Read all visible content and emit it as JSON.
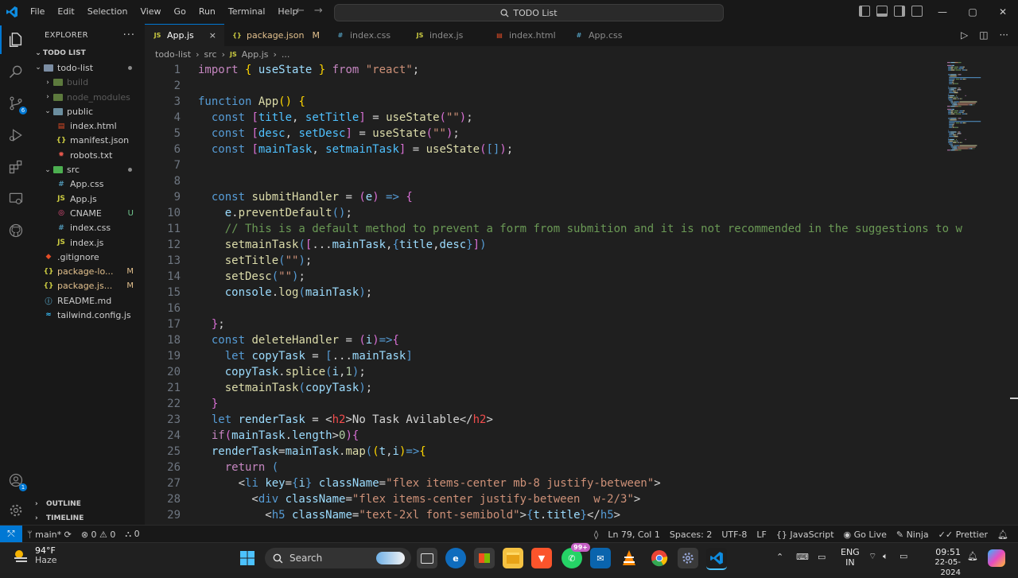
{
  "menu": [
    "File",
    "Edit",
    "Selection",
    "View",
    "Go",
    "Run",
    "Terminal",
    "Help"
  ],
  "command_center": "TODO List",
  "explorer": {
    "title": "EXPLORER",
    "section": "TODO LIST",
    "items": [
      {
        "label": "todo-list",
        "type": "folder-open",
        "depth": 1,
        "color": "#cccccc",
        "badge": "",
        "dot": true
      },
      {
        "label": "build",
        "type": "folder",
        "depth": 2,
        "color": "#5a5a5a",
        "badge": ""
      },
      {
        "label": "node_modules",
        "type": "folder",
        "depth": 2,
        "color": "#5a5a5a",
        "badge": ""
      },
      {
        "label": "public",
        "type": "folder-open",
        "depth": 2,
        "color": "#cccccc",
        "badge": ""
      },
      {
        "label": "index.html",
        "type": "html",
        "depth": 3,
        "color": "#cccccc",
        "badge": ""
      },
      {
        "label": "manifest.json",
        "type": "json",
        "depth": 3,
        "color": "#cccccc",
        "badge": ""
      },
      {
        "label": "robots.txt",
        "type": "txt",
        "depth": 3,
        "color": "#cccccc",
        "badge": ""
      },
      {
        "label": "src",
        "type": "folder-open",
        "depth": 2,
        "color": "#cccccc",
        "badge": "",
        "dot": true
      },
      {
        "label": "App.css",
        "type": "css",
        "depth": 3,
        "color": "#cccccc",
        "badge": ""
      },
      {
        "label": "App.js",
        "type": "js",
        "depth": 3,
        "color": "#cccccc",
        "badge": ""
      },
      {
        "label": "CNAME",
        "type": "cname",
        "depth": 3,
        "color": "#cccccc",
        "badge": "U"
      },
      {
        "label": "index.css",
        "type": "css",
        "depth": 3,
        "color": "#cccccc",
        "badge": ""
      },
      {
        "label": "index.js",
        "type": "js",
        "depth": 3,
        "color": "#cccccc",
        "badge": ""
      },
      {
        "label": ".gitignore",
        "type": "git",
        "depth": 2,
        "color": "#cccccc",
        "badge": ""
      },
      {
        "label": "package-lo...",
        "type": "json",
        "depth": 2,
        "color": "#e2c08d",
        "badge": "M"
      },
      {
        "label": "package.js...",
        "type": "json",
        "depth": 2,
        "color": "#e2c08d",
        "badge": "M"
      },
      {
        "label": "README.md",
        "type": "md",
        "depth": 2,
        "color": "#cccccc",
        "badge": ""
      },
      {
        "label": "tailwind.config.js",
        "type": "tw",
        "depth": 2,
        "color": "#cccccc",
        "badge": ""
      }
    ],
    "outline": "OUTLINE",
    "timeline": "TIMELINE"
  },
  "tabs": [
    {
      "label": "App.js",
      "icon": "js",
      "active": true,
      "suffix": "×"
    },
    {
      "label": "package.json",
      "icon": "json",
      "active": false,
      "suffix": "M"
    },
    {
      "label": "index.css",
      "icon": "css",
      "active": false,
      "suffix": ""
    },
    {
      "label": "index.js",
      "icon": "js",
      "active": false,
      "suffix": ""
    },
    {
      "label": "index.html",
      "icon": "html",
      "active": false,
      "suffix": ""
    },
    {
      "label": "App.css",
      "icon": "css",
      "active": false,
      "suffix": ""
    }
  ],
  "breadcrumb": [
    "todo-list",
    "src",
    "App.js",
    "..."
  ],
  "code_lines": [
    [
      [
        "k",
        "import "
      ],
      [
        "p",
        "{ "
      ],
      [
        "v",
        "useState"
      ],
      [
        "p",
        " }"
      ],
      [
        "k",
        " from "
      ],
      [
        "s",
        "\"react\""
      ],
      [
        "",
        "; "
      ]
    ],
    [],
    [
      [
        "t",
        "function "
      ],
      [
        "f",
        "App"
      ],
      [
        "p",
        "() {"
      ]
    ],
    [
      [
        "",
        "  "
      ],
      [
        "t",
        "const "
      ],
      [
        "b",
        "["
      ],
      [
        "cv",
        "title"
      ],
      [
        "",
        ", "
      ],
      [
        "cv",
        "setTitle"
      ],
      [
        "b",
        "]"
      ],
      [
        "",
        " = "
      ],
      [
        "f",
        "useState"
      ],
      [
        "b",
        "("
      ],
      [
        "s",
        "\"\""
      ],
      [
        "b",
        ")"
      ],
      [
        "",
        ";"
      ]
    ],
    [
      [
        "",
        "  "
      ],
      [
        "t",
        "const "
      ],
      [
        "b",
        "["
      ],
      [
        "cv",
        "desc"
      ],
      [
        "",
        ", "
      ],
      [
        "cv",
        "setDesc"
      ],
      [
        "b",
        "]"
      ],
      [
        "",
        " = "
      ],
      [
        "f",
        "useState"
      ],
      [
        "b",
        "("
      ],
      [
        "s",
        "\"\""
      ],
      [
        "b",
        ")"
      ],
      [
        "",
        ";"
      ]
    ],
    [
      [
        "",
        "  "
      ],
      [
        "t",
        "const "
      ],
      [
        "b",
        "["
      ],
      [
        "cv",
        "mainTask"
      ],
      [
        "",
        ", "
      ],
      [
        "cv",
        "setmainTask"
      ],
      [
        "b",
        "]"
      ],
      [
        "",
        " = "
      ],
      [
        "f",
        "useState"
      ],
      [
        "b",
        "("
      ],
      [
        "t",
        "[]"
      ],
      [
        "b",
        ")"
      ],
      [
        "",
        ";"
      ]
    ],
    [],
    [],
    [
      [
        "",
        "  "
      ],
      [
        "t",
        "const "
      ],
      [
        "f",
        "submitHandler"
      ],
      [
        "",
        " = "
      ],
      [
        "b",
        "("
      ],
      [
        "v",
        "e"
      ],
      [
        "b",
        ")"
      ],
      [
        "t",
        " => "
      ],
      [
        "b",
        "{"
      ]
    ],
    [
      [
        "",
        "    "
      ],
      [
        "v",
        "e"
      ],
      [
        "",
        "."
      ],
      [
        "f",
        "preventDefault"
      ],
      [
        "t",
        "()"
      ],
      [
        "",
        ";"
      ]
    ],
    [
      [
        "",
        "    "
      ],
      [
        "c",
        "// This is a default method to prevent a form from submition and it is not recommended in the suggestions to w"
      ]
    ],
    [
      [
        "",
        "    "
      ],
      [
        "f",
        "setmainTask"
      ],
      [
        "t",
        "("
      ],
      [
        "b",
        "["
      ],
      [
        "",
        "..."
      ],
      [
        "v",
        "mainTask"
      ],
      [
        "",
        ","
      ],
      [
        "t",
        "{"
      ],
      [
        "v",
        "title"
      ],
      [
        "",
        ","
      ],
      [
        "v",
        "desc"
      ],
      [
        "t",
        "}"
      ],
      [
        "b",
        "]"
      ],
      [
        "t",
        ")"
      ]
    ],
    [
      [
        "",
        "    "
      ],
      [
        "f",
        "setTitle"
      ],
      [
        "t",
        "("
      ],
      [
        "s",
        "\"\""
      ],
      [
        "t",
        ")"
      ],
      [
        "",
        ";"
      ]
    ],
    [
      [
        "",
        "    "
      ],
      [
        "f",
        "setDesc"
      ],
      [
        "t",
        "("
      ],
      [
        "s",
        "\"\""
      ],
      [
        "t",
        ")"
      ],
      [
        "",
        ";"
      ]
    ],
    [
      [
        "",
        "    "
      ],
      [
        "v",
        "console"
      ],
      [
        "",
        "."
      ],
      [
        "f",
        "log"
      ],
      [
        "t",
        "("
      ],
      [
        "v",
        "mainTask"
      ],
      [
        "t",
        ")"
      ],
      [
        "",
        ";"
      ]
    ],
    [],
    [
      [
        "",
        "  "
      ],
      [
        "b",
        "}"
      ],
      [
        "",
        ";"
      ]
    ],
    [
      [
        "",
        "  "
      ],
      [
        "t",
        "const "
      ],
      [
        "f",
        "deleteHandler"
      ],
      [
        "",
        " = "
      ],
      [
        "b",
        "("
      ],
      [
        "v",
        "i"
      ],
      [
        "b",
        ")"
      ],
      [
        "t",
        "=>"
      ],
      [
        "b",
        "{"
      ]
    ],
    [
      [
        "",
        "    "
      ],
      [
        "t",
        "let "
      ],
      [
        "v",
        "copyTask"
      ],
      [
        "",
        " = "
      ],
      [
        "t",
        "["
      ],
      [
        "",
        "..."
      ],
      [
        "v",
        "mainTask"
      ],
      [
        "t",
        "]"
      ]
    ],
    [
      [
        "",
        "    "
      ],
      [
        "v",
        "copyTask"
      ],
      [
        "",
        "."
      ],
      [
        "f",
        "splice"
      ],
      [
        "t",
        "("
      ],
      [
        "v",
        "i"
      ],
      [
        "",
        ","
      ],
      [
        "n",
        "1"
      ],
      [
        "t",
        ")"
      ],
      [
        "",
        ";"
      ]
    ],
    [
      [
        "",
        "    "
      ],
      [
        "f",
        "setmainTask"
      ],
      [
        "t",
        "("
      ],
      [
        "v",
        "copyTask"
      ],
      [
        "t",
        ")"
      ],
      [
        "",
        ";"
      ]
    ],
    [
      [
        "",
        "  "
      ],
      [
        "b",
        "}"
      ]
    ],
    [
      [
        "",
        "  "
      ],
      [
        "t",
        "let "
      ],
      [
        "v",
        "renderTask"
      ],
      [
        "",
        " = "
      ],
      [
        "",
        "<"
      ],
      [
        "tg",
        "h2"
      ],
      [
        "",
        ">No Task Avilable</"
      ],
      [
        "tg",
        "h2"
      ],
      [
        "",
        ">"
      ]
    ],
    [
      [
        "",
        "  "
      ],
      [
        "k",
        "if"
      ],
      [
        "b",
        "("
      ],
      [
        "v",
        "mainTask"
      ],
      [
        "",
        "."
      ],
      [
        "v",
        "length"
      ],
      [
        "",
        ">"
      ],
      [
        "n",
        "0"
      ],
      [
        "b",
        ")"
      ],
      [
        "b",
        "{"
      ]
    ],
    [
      [
        "",
        "  "
      ],
      [
        "v",
        "renderTask"
      ],
      [
        "",
        "="
      ],
      [
        "v",
        "mainTask"
      ],
      [
        "",
        "."
      ],
      [
        "f",
        "map"
      ],
      [
        "t",
        "("
      ],
      [
        "p",
        "("
      ],
      [
        "v",
        "t"
      ],
      [
        "",
        ","
      ],
      [
        "v",
        "i"
      ],
      [
        "p",
        ")"
      ],
      [
        "t",
        "=>"
      ],
      [
        "p",
        "{"
      ]
    ],
    [
      [
        "",
        "    "
      ],
      [
        "k",
        "return "
      ],
      [
        "t",
        "("
      ]
    ],
    [
      [
        "",
        "      <"
      ],
      [
        "t",
        "li "
      ],
      [
        "v",
        "key"
      ],
      [
        "",
        "="
      ],
      [
        "t",
        "{"
      ],
      [
        "v",
        "i"
      ],
      [
        "t",
        "}"
      ],
      [
        " ",
        ""
      ],
      [
        "v",
        " className"
      ],
      [
        "",
        "="
      ],
      [
        "s",
        "\"flex items-center mb-8 justify-between\""
      ],
      [
        "",
        ">"
      ]
    ],
    [
      [
        "",
        "        <"
      ],
      [
        "t",
        "div "
      ],
      [
        "v",
        "className"
      ],
      [
        "",
        "="
      ],
      [
        "s",
        "\"flex items-center justify-between  w-2/3\""
      ],
      [
        "",
        ">"
      ]
    ],
    [
      [
        "",
        "          <"
      ],
      [
        "t",
        "h5 "
      ],
      [
        "v",
        "className"
      ],
      [
        "",
        "="
      ],
      [
        "s",
        "\"text-2xl font-semibold\""
      ],
      [
        "",
        ">"
      ],
      [
        "t",
        "{"
      ],
      [
        "v",
        "t"
      ],
      [
        "",
        "."
      ],
      [
        "v",
        "title"
      ],
      [
        "t",
        "}"
      ],
      [
        "",
        "</"
      ],
      [
        "t",
        "h5"
      ],
      [
        "",
        ">"
      ]
    ]
  ],
  "status": {
    "branch": "main*",
    "errors": "0",
    "warnings": "0",
    "ports": "0",
    "position": "Ln 79, Col 1",
    "spaces": "Spaces: 2",
    "encoding": "UTF-8",
    "eol": "LF",
    "language": "JavaScript",
    "golive": "Go Live",
    "ninja": "Ninja",
    "prettier": "Prettier"
  },
  "taskbar": {
    "weather_temp": "94°F",
    "weather_desc": "Haze",
    "search": "Search",
    "lang1": "ENG",
    "lang2": "IN",
    "time": "09:51",
    "date": "22-05-2024",
    "whatsapp_badge": "99+"
  }
}
